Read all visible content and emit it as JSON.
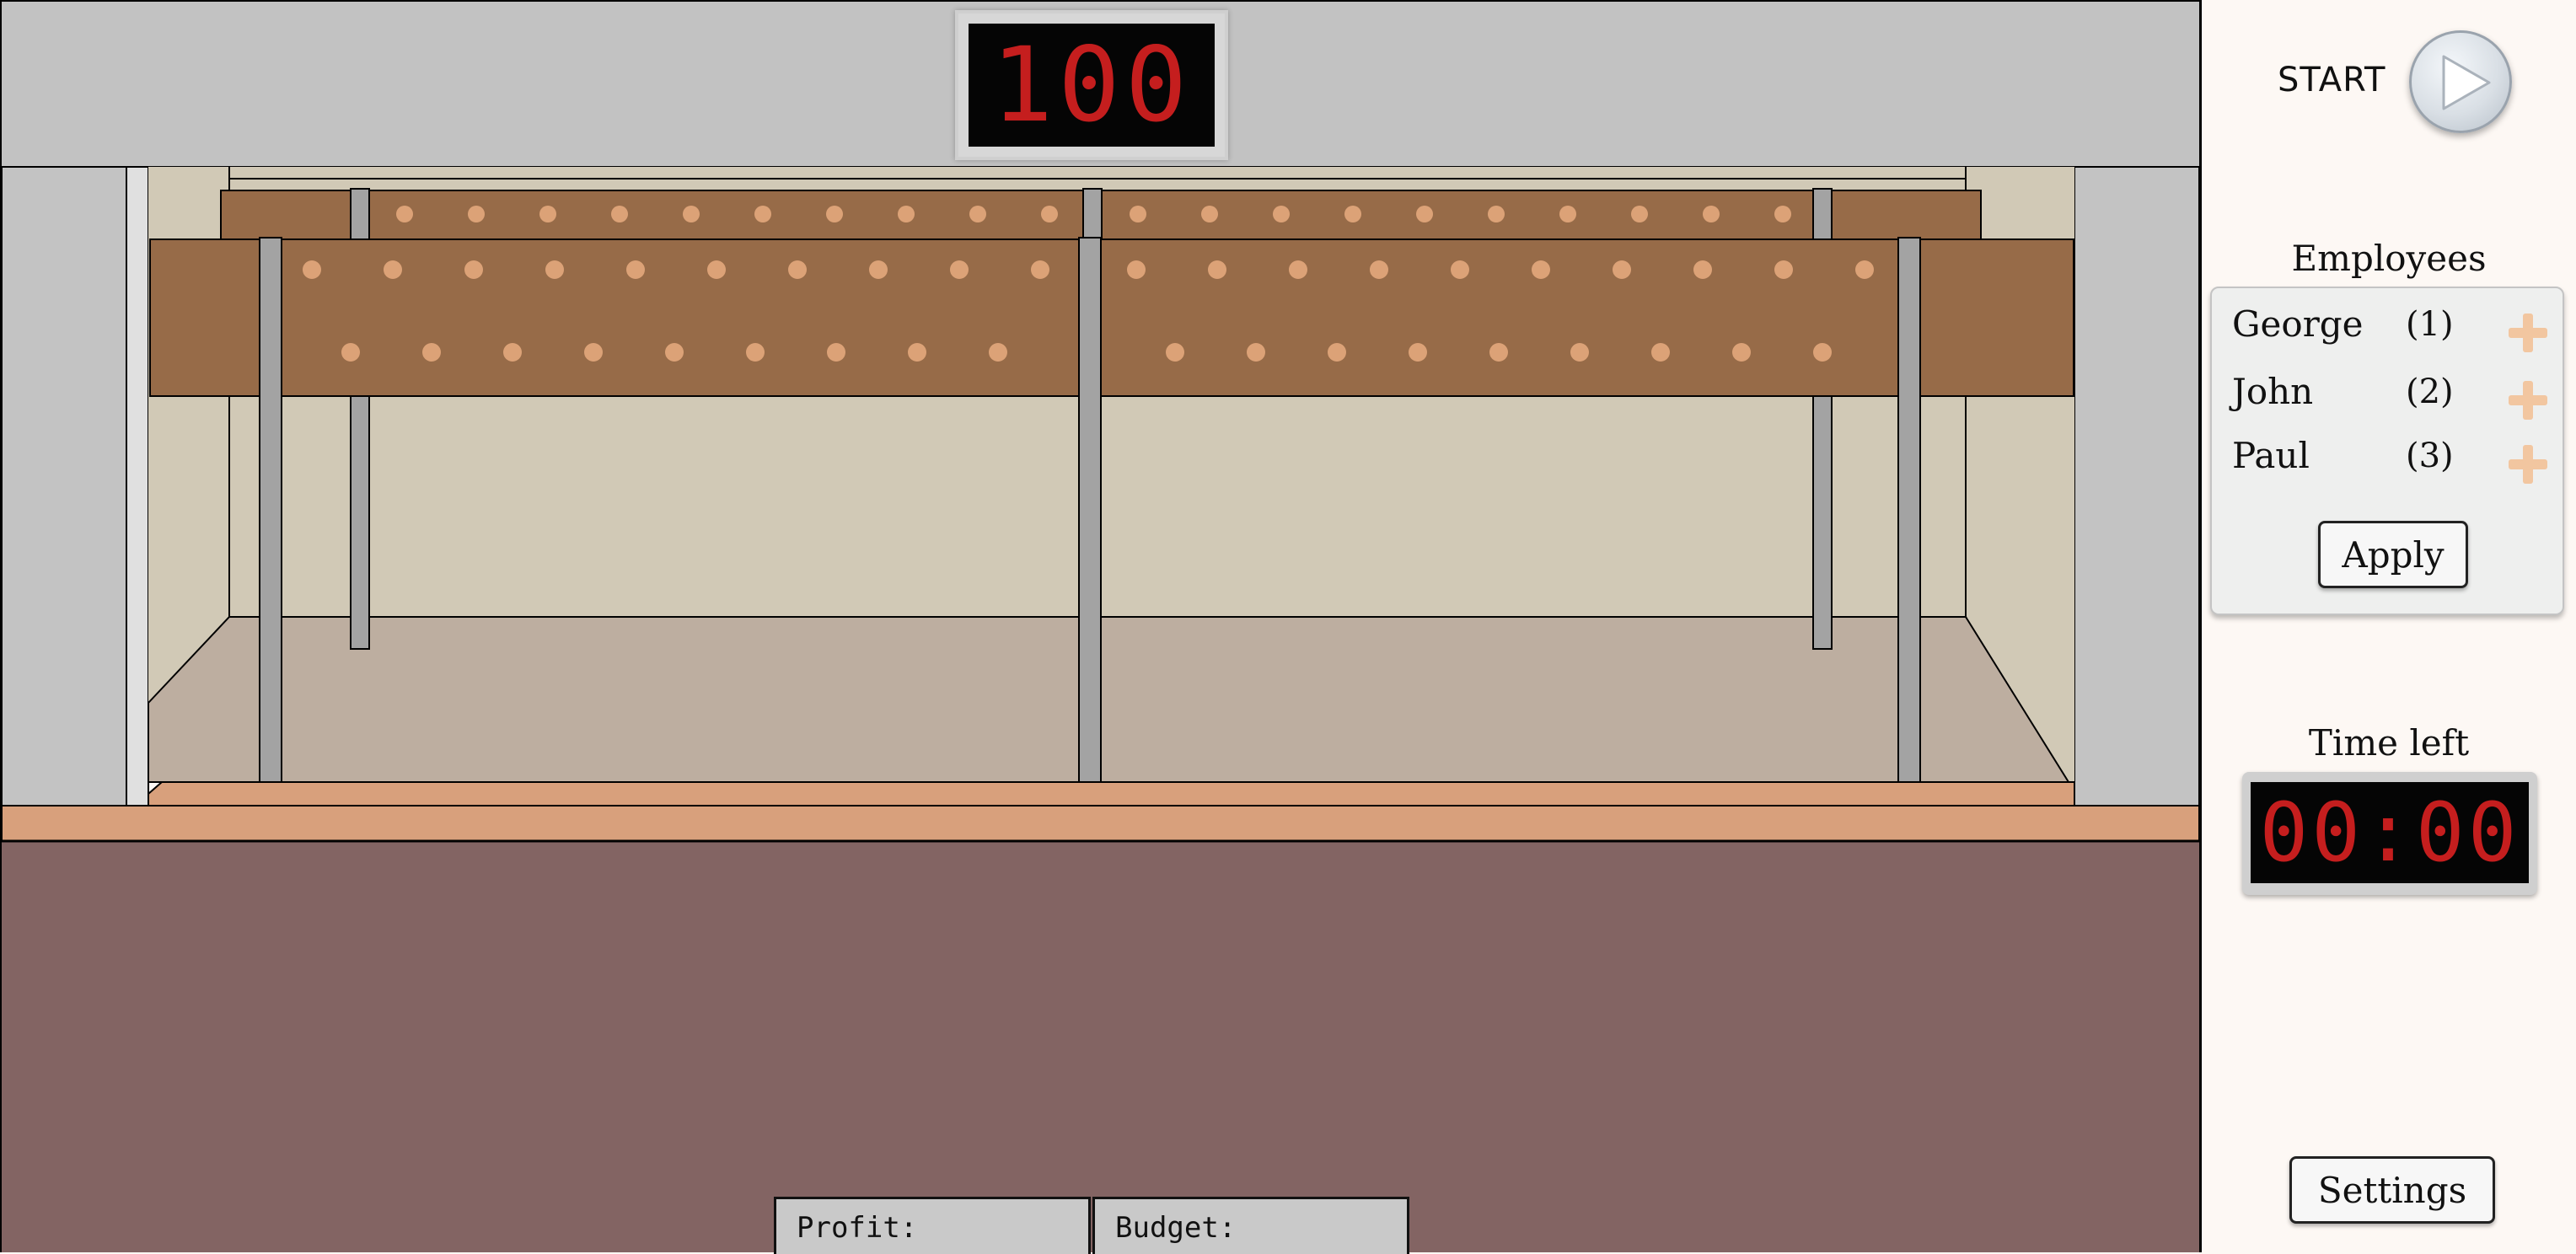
{
  "score": "100",
  "start_label": "START",
  "employees": {
    "title": "Employees",
    "list": [
      {
        "name": "George",
        "number": "(1)"
      },
      {
        "name": "John",
        "number": "(2)"
      },
      {
        "name": "Paul",
        "number": "(3)"
      }
    ],
    "apply_label": "Apply"
  },
  "timer": {
    "title": "Time left",
    "value": "00:00"
  },
  "settings_label": "Settings",
  "bottom_fields": {
    "profit_label": "Profit:",
    "budget_label": "Budget:"
  },
  "icons": {
    "start": "play-icon",
    "add_employee": "plus-icon"
  },
  "colors": {
    "wall": "#c2c2c2",
    "board": "#976b48",
    "peg": "#dca277",
    "back_wall": "#d1c9b6",
    "room_floor": "#bdaea0",
    "ledge": "#d8a07c",
    "floor": "#836463",
    "display_text": "#c51e1e"
  }
}
